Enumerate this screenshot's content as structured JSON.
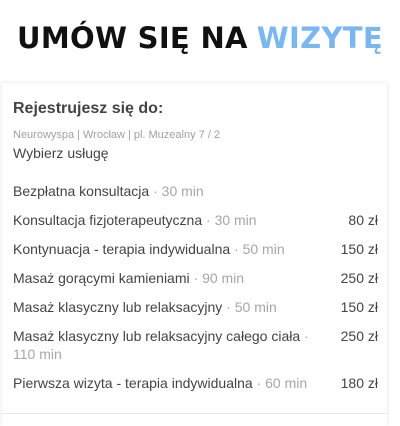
{
  "header": {
    "title_dark": "UMÓW SIĘ NA",
    "title_accent": "WIZYTĘ",
    "accent_color": "#7ab7f0"
  },
  "card": {
    "title": "Rejestrujesz się do:",
    "breadcrumb": [
      "Neurowyspa",
      "Wrocław",
      "pl. Muzealny 7 / 2"
    ],
    "choose_label": "Wybierz usługę",
    "services": [
      {
        "name": "Bezpłatna konsultacja",
        "duration": "30 min",
        "price": ""
      },
      {
        "name": "Konsultacja fizjoterapeutyczna",
        "duration": "30 min",
        "price": "80 zł"
      },
      {
        "name": "Kontynuacja - terapia indywidualna",
        "duration": "50 min",
        "price": "150 zł"
      },
      {
        "name": "Masaż gorącymi kamieniami",
        "duration": "90 min",
        "price": "250 zł"
      },
      {
        "name": "Masaż klasyczny lub relaksacyjny",
        "duration": "50 min",
        "price": "150 zł"
      },
      {
        "name": "Masaż klasyczny lub relaksacyjny całego ciała",
        "duration": "110 min",
        "price": "250 zł"
      },
      {
        "name": "Pierwsza wizyta - terapia indywidualna",
        "duration": "60 min",
        "price": "180 zł"
      }
    ]
  }
}
